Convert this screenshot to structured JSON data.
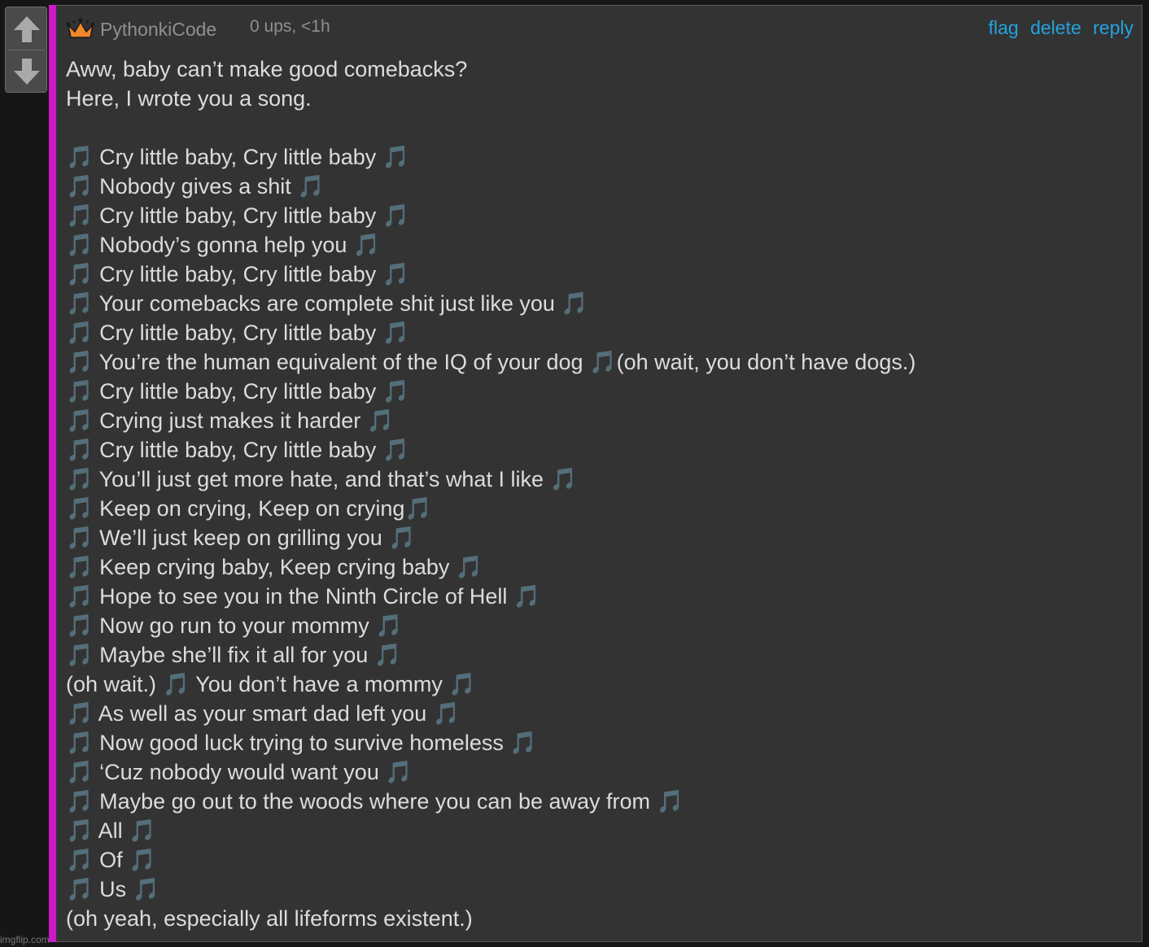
{
  "vote": {
    "up_icon": "arrow-up-icon",
    "down_icon": "arrow-down-icon"
  },
  "colors": {
    "accent_bar": "#cc1ac6",
    "link": "#23a3e0",
    "background": "#333333",
    "text": "#dcdcdc",
    "muted": "#8f8f8f"
  },
  "comment": {
    "badge_icon": "crown-icon",
    "username": "PythonkiCode",
    "meta": "0 ups, <1h",
    "actions": {
      "flag": "flag",
      "delete": "delete",
      "reply": "reply"
    },
    "lines": [
      "Aww, baby can’t make good comebacks?",
      "Here, I wrote you a song.",
      "",
      "🎵 Cry little baby, Cry little baby 🎵",
      "🎵 Nobody gives a shit 🎵",
      "🎵 Cry little baby, Cry little baby 🎵",
      "🎵 Nobody’s gonna help you 🎵",
      "🎵 Cry little baby, Cry little baby 🎵",
      "🎵 Your comebacks are complete shit just like you 🎵",
      "🎵 Cry little baby, Cry little baby 🎵",
      "🎵 You’re the human equivalent of the IQ of your dog 🎵(oh wait, you don’t have dogs.)",
      "🎵 Cry little baby, Cry little baby 🎵",
      "🎵 Crying just makes it harder 🎵",
      "🎵 Cry little baby, Cry little baby 🎵",
      "🎵 You’ll just get more hate, and that’s what I like 🎵",
      "🎵 Keep on crying, Keep on crying🎵",
      "🎵 We’ll just keep on grilling you 🎵",
      "🎵 Keep crying baby, Keep crying baby 🎵",
      "🎵 Hope to see you in the Ninth Circle of Hell 🎵",
      "🎵 Now go run to your mommy 🎵",
      "🎵 Maybe she’ll fix it all for you 🎵",
      "(oh wait.) 🎵 You don’t have a mommy 🎵",
      "🎵 As well as your smart dad left you 🎵",
      "🎵 Now good luck trying to survive homeless 🎵",
      "🎵 ‘Cuz nobody would want you 🎵",
      "🎵 Maybe go out to the woods where you can be away from 🎵",
      "🎵 All 🎵",
      "🎵 Of 🎵",
      "🎵 Us 🎵",
      "(oh yeah, especially all lifeforms existent.)"
    ]
  },
  "watermark": "imgflip.com"
}
